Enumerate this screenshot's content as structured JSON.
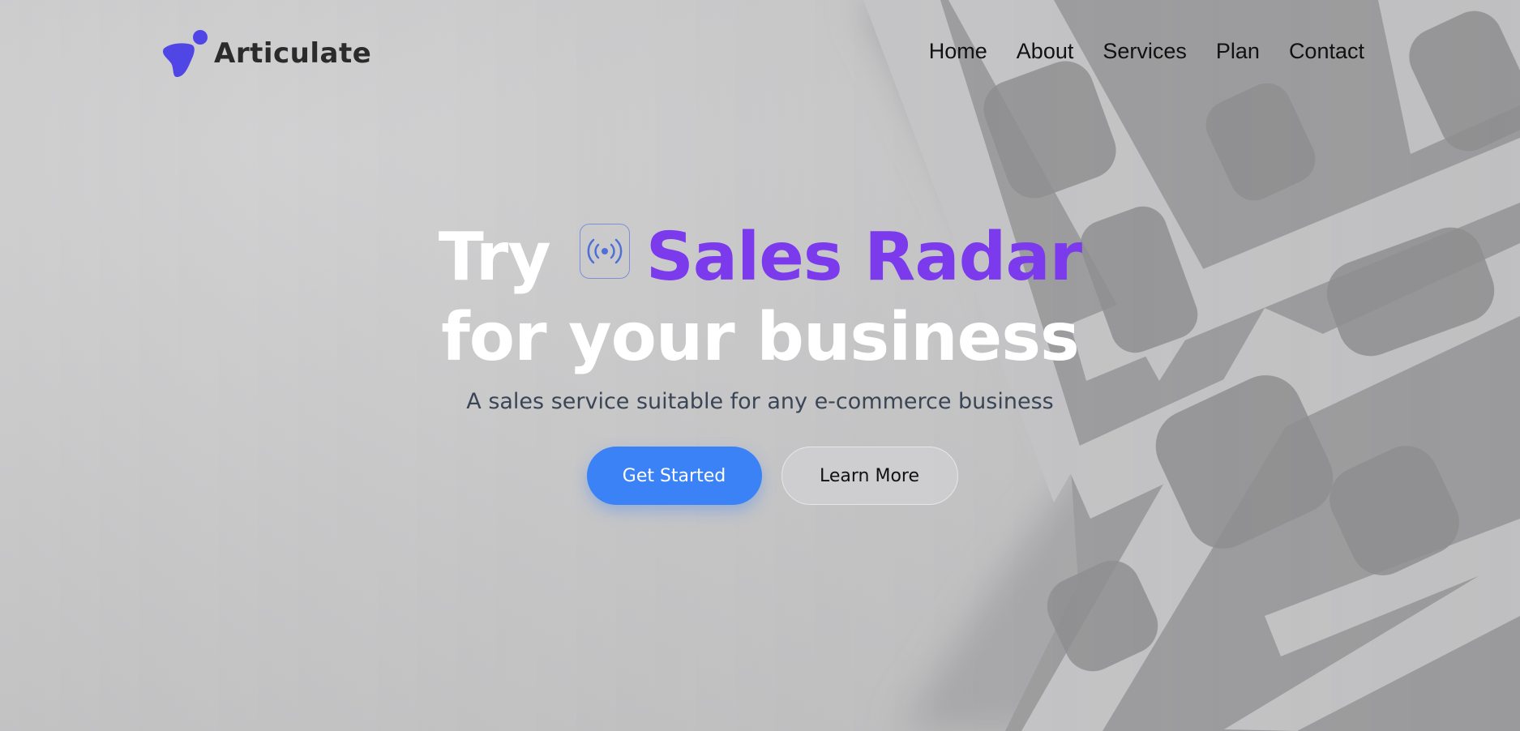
{
  "brand": {
    "name": "Articulate",
    "logo_icon": "blob-logo-icon",
    "logo_color": "#4f46e5"
  },
  "nav": {
    "items": [
      "Home",
      "About",
      "Services",
      "Plan",
      "Contact"
    ]
  },
  "hero": {
    "title_prefix": "Try",
    "product_icon": "radar-broadcast-icon",
    "product_name": "Sales Radar",
    "title_line2": "for your business",
    "subtitle": "A sales service suitable for any e-commerce business",
    "primary_cta": "Get Started",
    "secondary_cta": "Learn More"
  },
  "colors": {
    "accent_purple": "#7c3aed",
    "primary_blue": "#3b82f6",
    "title_white": "#ffffff",
    "icon_blue": "#4f6fd8"
  }
}
